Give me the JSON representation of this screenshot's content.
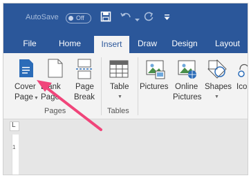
{
  "titlebar": {
    "autosave_label": "AutoSave",
    "toggle_state": "Off",
    "icons": [
      "save-icon",
      "undo-icon",
      "redo-icon",
      "customize-qat-icon"
    ]
  },
  "tabs": [
    {
      "label": "File",
      "active": false
    },
    {
      "label": "Home",
      "active": false
    },
    {
      "label": "Insert",
      "active": true
    },
    {
      "label": "Draw",
      "active": false
    },
    {
      "label": "Design",
      "active": false
    },
    {
      "label": "Layout",
      "active": false
    }
  ],
  "ribbon": {
    "pages_group": {
      "label": "Pages",
      "buttons": [
        {
          "line1": "Cover",
          "line2": "Page"
        },
        {
          "line1": "Blank",
          "line2": "Page"
        },
        {
          "line1": "Page",
          "line2": "Break"
        }
      ]
    },
    "tables_group": {
      "label": "Tables",
      "buttons": [
        {
          "line1": "Table"
        }
      ]
    },
    "illustrations_group": {
      "buttons": [
        {
          "line1": "Pictures"
        },
        {
          "line1": "Online",
          "line2": "Pictures"
        },
        {
          "line1": "Shapes"
        },
        {
          "line1": "Ico"
        }
      ]
    }
  },
  "ruler": {
    "corner_mark": "L",
    "tick": "1"
  },
  "colors": {
    "titlebar": "#2b579a",
    "ribbon": "#f3f3f3",
    "annotation_arrow": "#f0457a",
    "icon_blue": "#2b6cb8"
  }
}
